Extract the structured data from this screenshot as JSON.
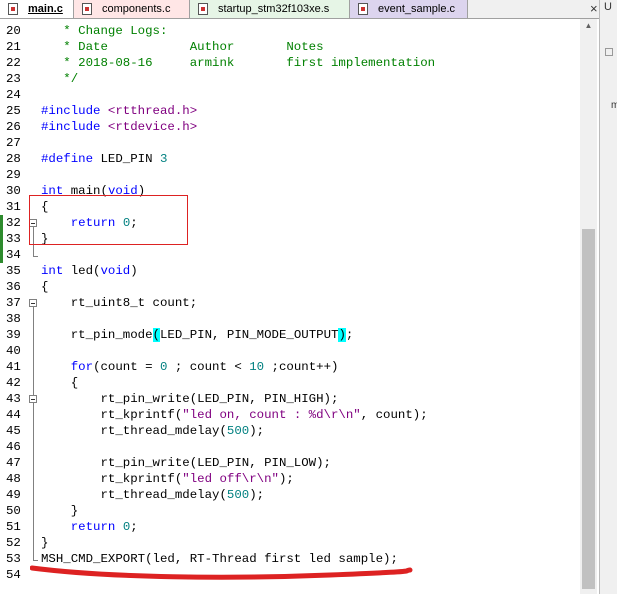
{
  "tabs": [
    {
      "label": "main.c",
      "active": true
    },
    {
      "label": "components.c",
      "active": false
    },
    {
      "label": "startup_stm32f103xe.s",
      "active": false
    },
    {
      "label": "event_sample.c",
      "active": false
    }
  ],
  "close_glyph": "×",
  "right_panel": {
    "letter": "U",
    "mark": "m"
  },
  "colors": {
    "keyword": "#0000ff",
    "comment": "#008000",
    "string": "#800080",
    "number": "#008080",
    "bracket_highlight": "#00ffff",
    "annotation": "#dd2222",
    "change_bar": "#2e8b2e"
  },
  "editor": {
    "lines": [
      {
        "n": "20",
        "segs": [
          {
            "t": "   * Change Logs:",
            "c": "cm"
          }
        ]
      },
      {
        "n": "21",
        "segs": [
          {
            "t": "   * Date           Author       Notes",
            "c": "cm"
          }
        ]
      },
      {
        "n": "22",
        "segs": [
          {
            "t": "   * 2018-08-16     armink       first implementation",
            "c": "cm"
          }
        ]
      },
      {
        "n": "23",
        "segs": [
          {
            "t": "   */",
            "c": "cm"
          }
        ]
      },
      {
        "n": "24",
        "segs": []
      },
      {
        "n": "25",
        "segs": [
          {
            "t": "#include ",
            "c": "kw"
          },
          {
            "t": "<rtthread.h>",
            "c": "str"
          }
        ]
      },
      {
        "n": "26",
        "segs": [
          {
            "t": "#include ",
            "c": "kw"
          },
          {
            "t": "<rtdevice.h>",
            "c": "str"
          }
        ]
      },
      {
        "n": "27",
        "segs": []
      },
      {
        "n": "28",
        "segs": [
          {
            "t": "#define ",
            "c": "kw"
          },
          {
            "t": "LED_PIN ",
            "c": ""
          },
          {
            "t": "3",
            "c": "num"
          }
        ]
      },
      {
        "n": "29",
        "segs": []
      },
      {
        "n": "30",
        "segs": [
          {
            "t": "int",
            "c": "kw"
          },
          {
            "t": " main(",
            "c": ""
          },
          {
            "t": "void",
            "c": "kw"
          },
          {
            "t": ")",
            "c": ""
          }
        ]
      },
      {
        "n": "31",
        "segs": [
          {
            "t": "{",
            "c": ""
          }
        ]
      },
      {
        "n": "32",
        "segs": [
          {
            "t": "    ",
            "c": ""
          },
          {
            "t": "return",
            "c": "kw"
          },
          {
            "t": " ",
            "c": ""
          },
          {
            "t": "0",
            "c": "num"
          },
          {
            "t": ";",
            "c": ""
          }
        ]
      },
      {
        "n": "33",
        "segs": [
          {
            "t": "}",
            "c": ""
          }
        ]
      },
      {
        "n": "34",
        "segs": []
      },
      {
        "n": "35",
        "segs": [
          {
            "t": "int",
            "c": "kw"
          },
          {
            "t": " led(",
            "c": ""
          },
          {
            "t": "void",
            "c": "kw"
          },
          {
            "t": ")",
            "c": ""
          }
        ]
      },
      {
        "n": "36",
        "segs": [
          {
            "t": "{",
            "c": ""
          }
        ]
      },
      {
        "n": "37",
        "segs": [
          {
            "t": "    rt_uint8_t count;",
            "c": ""
          }
        ]
      },
      {
        "n": "38",
        "segs": []
      },
      {
        "n": "39",
        "segs": [
          {
            "t": "    rt_pin_mode",
            "c": ""
          },
          {
            "t": "(",
            "c": "hl"
          },
          {
            "t": "LED_PIN, PIN_MODE_OUTPUT",
            "c": ""
          },
          {
            "t": ")",
            "c": "hl"
          },
          {
            "t": ";",
            "c": ""
          }
        ]
      },
      {
        "n": "40",
        "segs": []
      },
      {
        "n": "41",
        "segs": [
          {
            "t": "    ",
            "c": ""
          },
          {
            "t": "for",
            "c": "kw"
          },
          {
            "t": "(count = ",
            "c": ""
          },
          {
            "t": "0",
            "c": "num"
          },
          {
            "t": " ; count < ",
            "c": ""
          },
          {
            "t": "10",
            "c": "num"
          },
          {
            "t": " ;count++)",
            "c": ""
          }
        ]
      },
      {
        "n": "42",
        "segs": [
          {
            "t": "    {",
            "c": ""
          }
        ]
      },
      {
        "n": "43",
        "segs": [
          {
            "t": "        rt_pin_write(LED_PIN, PIN_HIGH);",
            "c": ""
          }
        ]
      },
      {
        "n": "44",
        "segs": [
          {
            "t": "        rt_kprintf(",
            "c": ""
          },
          {
            "t": "\"led on, count : %d\\r\\n\"",
            "c": "str"
          },
          {
            "t": ", count);",
            "c": ""
          }
        ]
      },
      {
        "n": "45",
        "segs": [
          {
            "t": "        rt_thread_mdelay(",
            "c": ""
          },
          {
            "t": "500",
            "c": "num"
          },
          {
            "t": ");",
            "c": ""
          }
        ]
      },
      {
        "n": "46",
        "segs": []
      },
      {
        "n": "47",
        "segs": [
          {
            "t": "        rt_pin_write(LED_PIN, PIN_LOW);",
            "c": ""
          }
        ]
      },
      {
        "n": "48",
        "segs": [
          {
            "t": "        rt_kprintf(",
            "c": ""
          },
          {
            "t": "\"led off\\r\\n\"",
            "c": "str"
          },
          {
            "t": ");",
            "c": ""
          }
        ]
      },
      {
        "n": "49",
        "segs": [
          {
            "t": "        rt_thread_mdelay(",
            "c": ""
          },
          {
            "t": "500",
            "c": "num"
          },
          {
            "t": ");",
            "c": ""
          }
        ]
      },
      {
        "n": "50",
        "segs": [
          {
            "t": "    }",
            "c": ""
          }
        ]
      },
      {
        "n": "51",
        "segs": [
          {
            "t": "    ",
            "c": ""
          },
          {
            "t": "return",
            "c": "kw"
          },
          {
            "t": " ",
            "c": ""
          },
          {
            "t": "0",
            "c": "num"
          },
          {
            "t": ";",
            "c": ""
          }
        ]
      },
      {
        "n": "52",
        "segs": [
          {
            "t": "}",
            "c": ""
          }
        ]
      },
      {
        "n": "53",
        "segs": [
          {
            "t": "MSH_CMD_EXPORT(led, RT-Thread first led sample);",
            "c": ""
          }
        ]
      },
      {
        "n": "54",
        "segs": []
      }
    ]
  }
}
